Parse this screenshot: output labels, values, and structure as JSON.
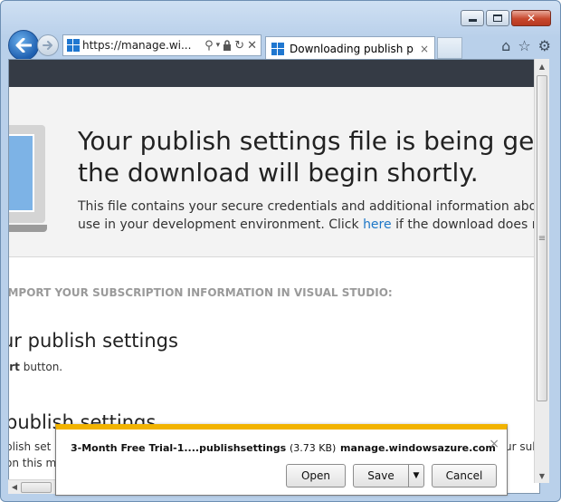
{
  "browser": {
    "address_url": "https://manage.wi...",
    "tab_title": "Downloading publish pro...",
    "tab_close": "×",
    "icons": [
      "back-icon",
      "forward-icon",
      "windows-logo-icon",
      "search-icon",
      "lock-icon",
      "refresh-icon",
      "stop-icon",
      "home-icon",
      "favorites-star-icon",
      "tools-gear-icon"
    ]
  },
  "hero": {
    "heading_line1": "Your publish settings file is being gene",
    "heading_line2": "the download will begin shortly.",
    "desc_line1": "This file contains your secure credentials and additional information about yo",
    "desc_line2_before": "use in your development environment. Click ",
    "desc_link": "here",
    "desc_line2_after": " if the download does not st"
  },
  "steps": {
    "header": "IMPORT YOUR SUBSCRIPTION INFORMATION IN VISUAL STUDIO:",
    "step1_heading": "ur publish settings",
    "step1_bold": "ort",
    "step1_text": " button.",
    "step2_heading": "publish settings",
    "step2_line1": "blish set",
    "step2_line2": "on this m",
    "step2_right": "ur sub"
  },
  "download_bar": {
    "filename": "3-Month Free Trial-1....publishsettings",
    "size": "(3.73 KB)",
    "host": "manage.windowsazure.com",
    "close": "×",
    "open_label": "Open",
    "save_label": "Save",
    "cancel_label": "Cancel"
  },
  "colors": {
    "accent_link": "#1e77c7",
    "topbar": "#353b45",
    "dl_bar_accent": "#f2b300"
  }
}
